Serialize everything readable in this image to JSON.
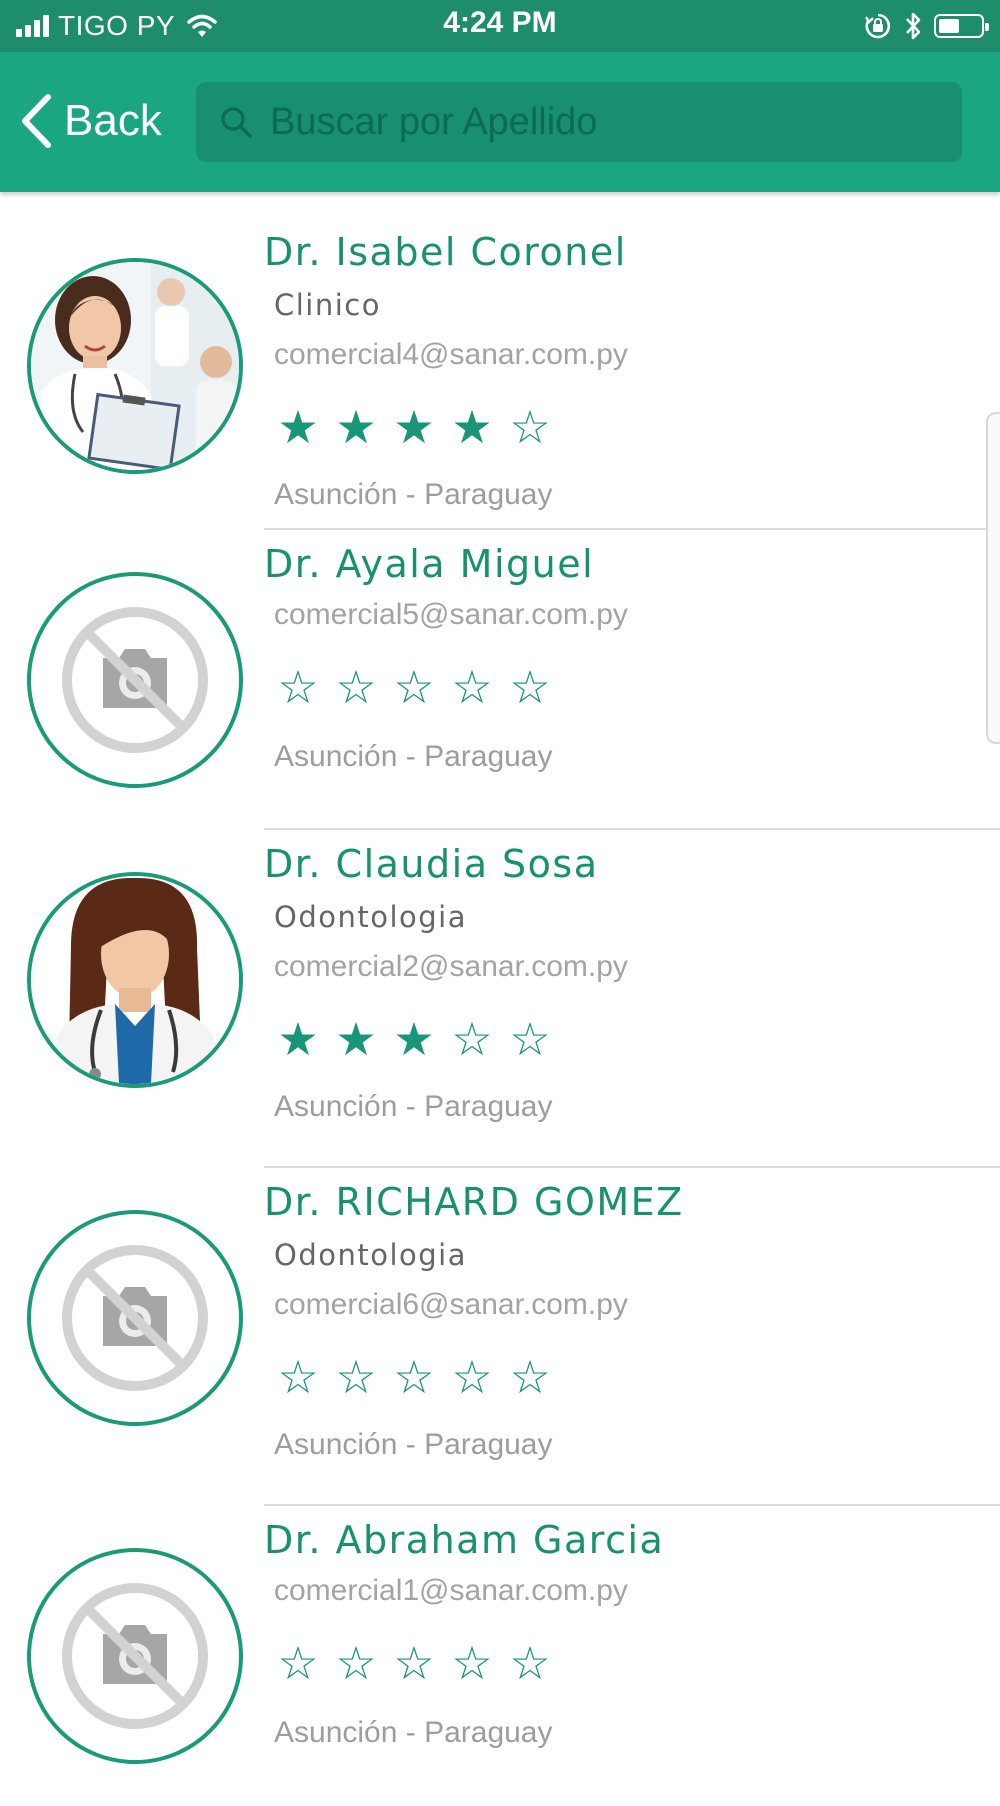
{
  "status_bar": {
    "carrier": "TIGO PY",
    "time": "4:24 PM",
    "icons": [
      "signal-icon",
      "wifi-icon",
      "orientation-lock-icon",
      "bluetooth-icon",
      "battery-icon"
    ]
  },
  "nav": {
    "back_label": "Back",
    "search_placeholder": "Buscar por Apellido"
  },
  "colors": {
    "status_bar": "#1d8d6c",
    "nav_bar": "#1aa680",
    "search_field": "#188f6f",
    "accent": "#17926f",
    "divider": "#dcdcdc"
  },
  "doctors": [
    {
      "name": "Dr. Isabel Coronel",
      "specialty": "Clinico",
      "email": "comercial4@sanar.com.py",
      "rating": 4,
      "location": "Asunción - Paraguay",
      "avatar": "photo-female-doctor"
    },
    {
      "name": "Dr. Ayala Miguel",
      "specialty": "",
      "email": "comercial5@sanar.com.py",
      "rating": 0,
      "location": "Asunción - Paraguay",
      "avatar": "no-photo-icon"
    },
    {
      "name": "Dr. Claudia Sosa",
      "specialty": "Odontologia",
      "email": "comercial2@sanar.com.py",
      "rating": 3,
      "location": "Asunción - Paraguay",
      "avatar": "illustration-female-doctor"
    },
    {
      "name": "Dr. RICHARD GOMEZ",
      "specialty": "Odontologia",
      "email": "comercial6@sanar.com.py",
      "rating": 0,
      "location": "Asunción - Paraguay",
      "avatar": "no-photo-icon"
    },
    {
      "name": "Dr. Abraham Garcia",
      "specialty": "",
      "email": "comercial1@sanar.com.py",
      "rating": 0,
      "location": "Asunción - Paraguay",
      "avatar": "no-photo-icon"
    }
  ]
}
